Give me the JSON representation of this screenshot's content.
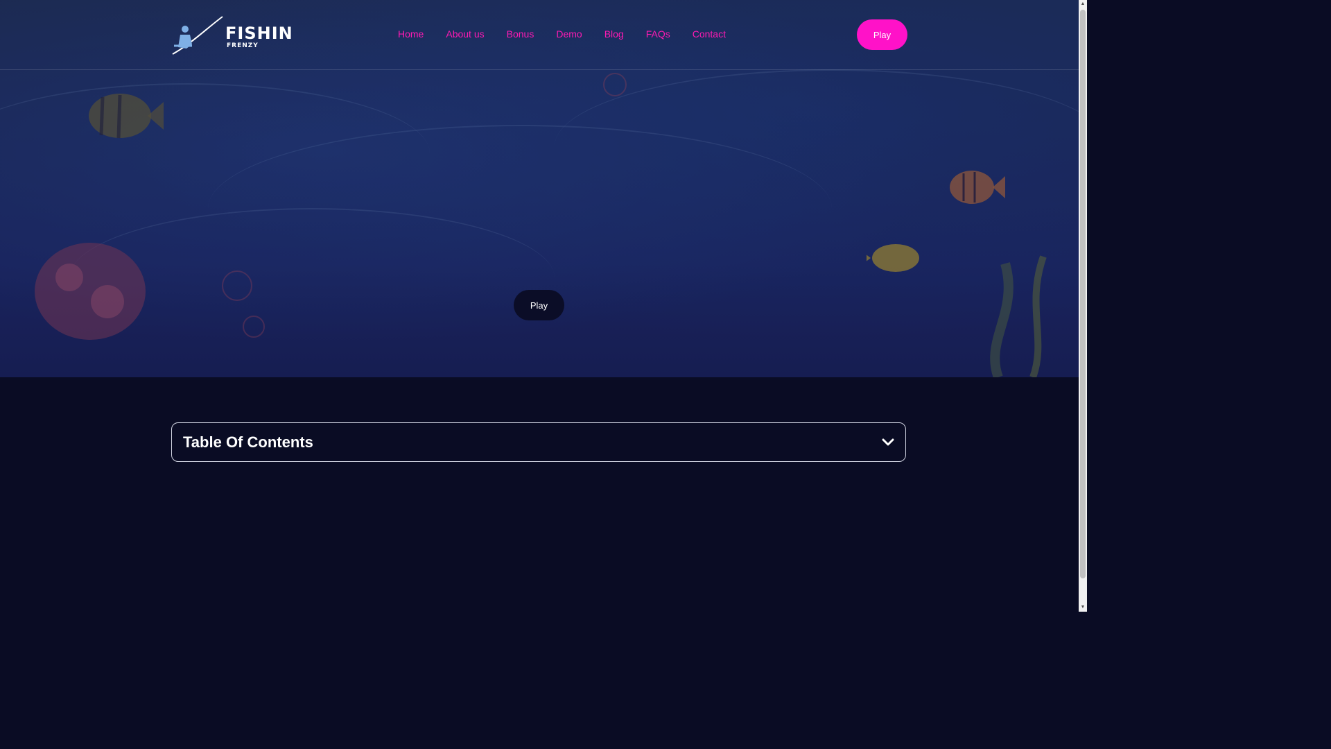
{
  "logo": {
    "title": "FISHIN",
    "subtitle": "FRENZY"
  },
  "nav": {
    "items": [
      "Home",
      "About us",
      "Bonus",
      "Demo",
      "Blog",
      "FAQs",
      "Contact"
    ]
  },
  "header": {
    "play_label": "Play"
  },
  "hero": {
    "play_label": "Play"
  },
  "toc": {
    "title": "Table Of Contents"
  },
  "colors": {
    "accent": "#ff12c8",
    "nav_link": "#ff1ab3",
    "background": "#0a0c24"
  }
}
